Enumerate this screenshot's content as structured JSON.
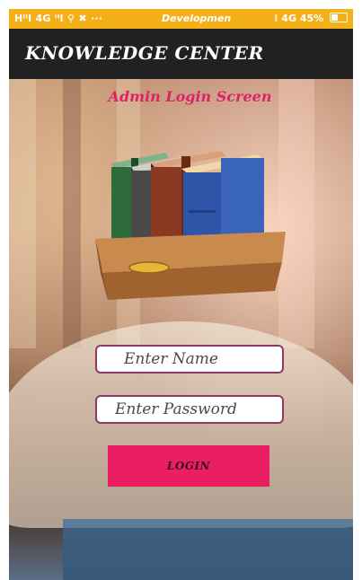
{
  "status_bar": {
    "left": "Hᴵᴵl 4G ᴵᴵl ⚲ ✖ ···",
    "center": "Developmen",
    "right": "⁞ 4G 45%"
  },
  "app_bar": {
    "title": "KNOWLEDGE CENTER"
  },
  "screen": {
    "title": "Admin Login Screen"
  },
  "form": {
    "name_placeholder": "Enter Name",
    "password_placeholder": "Enter Password",
    "login_label": "LOGIN"
  },
  "colors": {
    "status_bar": "#f3b019",
    "app_bar": "#212121",
    "title_accent": "#e0206a",
    "button": "#e91e63"
  },
  "icons": {
    "illustration": "books-in-tray-icon"
  }
}
